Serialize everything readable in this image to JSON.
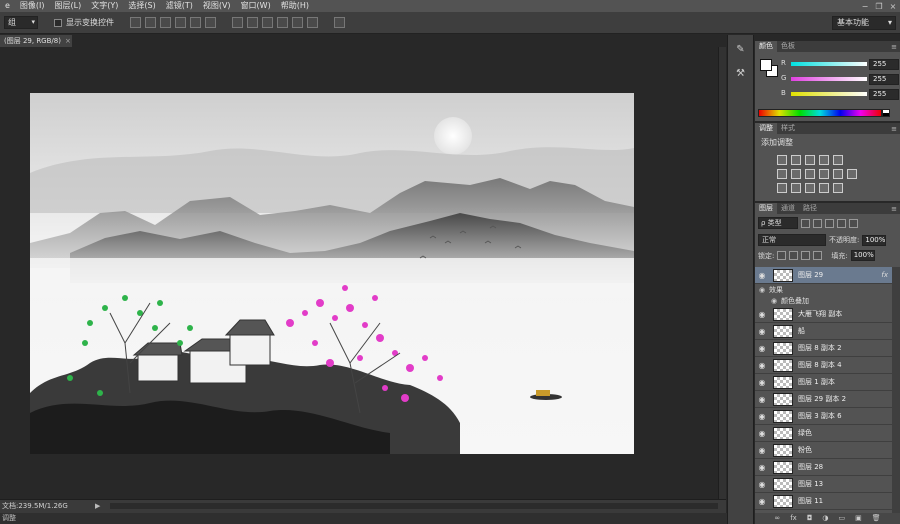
{
  "menu": [
    "图像(I)",
    "图层(L)",
    "文字(Y)",
    "选择(S)",
    "滤镜(T)",
    "视图(V)",
    "窗口(W)",
    "帮助(H)"
  ],
  "menu_first": "e",
  "options": {
    "mode_value": "组",
    "show_transform_label": "显示变换控件",
    "workspace": "基本功能"
  },
  "document": {
    "tab_title": "(图层 29, RGB/8)",
    "tab_close": "×",
    "status_text": "文档:239.5M/1.26G",
    "status_arrow": "▶",
    "bottom_label": "调整"
  },
  "color_panel": {
    "tabs": [
      "颜色",
      "色板"
    ],
    "channels": [
      {
        "name": "R",
        "value": "255",
        "color": "#00e0e0"
      },
      {
        "name": "G",
        "value": "255",
        "color": "#e040e0"
      },
      {
        "name": "B",
        "value": "255",
        "color": "#e0e000"
      }
    ]
  },
  "adjust_panel": {
    "tabs": [
      "调整",
      "样式"
    ],
    "title": "添加调整"
  },
  "layers_panel": {
    "tabs": [
      "图层",
      "通道",
      "路径"
    ],
    "kind": "ρ 类型",
    "blend_mode": "正常",
    "opacity_label": "不透明度:",
    "opacity_value": "100%",
    "lock_label": "锁定:",
    "fill_label": "填充:",
    "fill_value": "100%",
    "effects_label": "效果",
    "effect_item": "颜色叠加",
    "layers": [
      {
        "name": "图层 29",
        "fx": "fx"
      },
      {
        "name": "大雁飞翔 副本"
      },
      {
        "name": "船"
      },
      {
        "name": "图层 8 副本 2"
      },
      {
        "name": "图层 8 副本 4"
      },
      {
        "name": "图层 1 副本"
      },
      {
        "name": "图层 29 副本 2"
      },
      {
        "name": "图层 3 副本 6"
      },
      {
        "name": "绿色"
      },
      {
        "name": "粉色"
      },
      {
        "name": "图层 28"
      },
      {
        "name": "图层 13"
      },
      {
        "name": "图层 11"
      }
    ],
    "footer_icons": [
      "∞",
      "fx",
      "◘",
      "◑",
      "▭",
      "▣",
      "🗑"
    ]
  },
  "colors": {
    "selected_layer": "#6a7a8f",
    "panel_bg": "#535353",
    "workspace_bg": "#282828"
  }
}
